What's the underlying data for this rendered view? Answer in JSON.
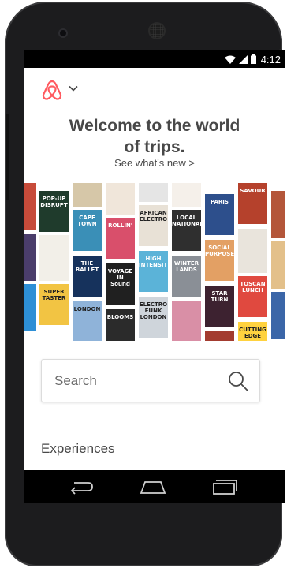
{
  "status_bar": {
    "time": "4:12"
  },
  "header": {
    "title": "Welcome to the world\nof trips.",
    "see_whats_new": "See what's new >"
  },
  "collage": {
    "posters": [
      {
        "text": "POP-UP\nDISRUPT",
        "color": "#1f3b2c"
      },
      {
        "text": "CAPE\nTOWN",
        "color": "#3a8fb7"
      },
      {
        "text": "ROLLIN'",
        "color": "#d94f6b"
      },
      {
        "text": "AFRICAN\nELECTRO",
        "color": "#e8e1d6"
      },
      {
        "text": "LOCAL\nNATIONAL",
        "color": "#2f2f2f"
      },
      {
        "text": "PARIS",
        "color": "#2d4f8c"
      },
      {
        "text": "SAVOUR",
        "color": "#b5412c"
      },
      {
        "text": "THE\nBALLET",
        "color": "#16325c"
      },
      {
        "text": "VOYAGE\nIN\nSound",
        "color": "#202020"
      },
      {
        "text": "HIGH\nINTENSITY",
        "color": "#5bb3d8"
      },
      {
        "text": "WINTER\nLANDS",
        "color": "#8a8f96"
      },
      {
        "text": "SOCIAL\nPURPOSE",
        "color": "#e3a064"
      },
      {
        "text": "SUPER\nTASTER",
        "color": "#f2c443"
      },
      {
        "text": "LONDON",
        "color": "#8fb3d9"
      },
      {
        "text": "STAR\nTURN",
        "color": "#3d2230"
      },
      {
        "text": "TOSCAN\nLUNCH",
        "color": "#e0493f"
      },
      {
        "text": "BLOOMS",
        "color": "#2b2b2b"
      },
      {
        "text": "ELECTRO\nFUNK LONDON",
        "color": "#cfd5db"
      },
      {
        "text": "CUTTING\nEDGE",
        "color": "#ffd23f"
      }
    ]
  },
  "search": {
    "placeholder": "Search"
  },
  "sections": {
    "experiences": "Experiences"
  },
  "colors": {
    "brand": "#FF5A5F",
    "text": "#484848"
  }
}
